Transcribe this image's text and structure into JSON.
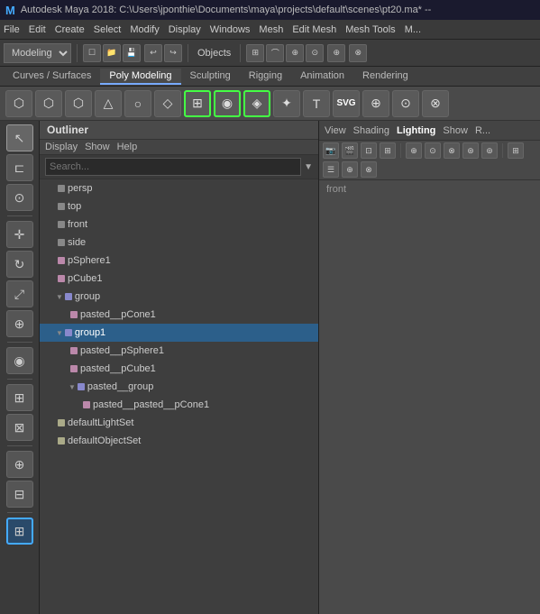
{
  "titlebar": {
    "logo": "M",
    "text": "Autodesk Maya 2018: C:\\Users\\jponthie\\Documents\\maya\\projects\\default\\scenes\\pt20.ma* --"
  },
  "menubar": {
    "items": [
      "File",
      "Edit",
      "Create",
      "Select",
      "Modify",
      "Display",
      "Windows",
      "Mesh",
      "Edit Mesh",
      "Mesh Tools",
      "M..."
    ]
  },
  "toolbar": {
    "mode": "Modeling",
    "objects_label": "Objects"
  },
  "shelf_tabs": {
    "items": [
      {
        "label": "Curves / Surfaces",
        "active": false
      },
      {
        "label": "Poly Modeling",
        "active": true
      },
      {
        "label": "Sculpting",
        "active": false
      },
      {
        "label": "Rigging",
        "active": false
      },
      {
        "label": "Animation",
        "active": false
      },
      {
        "label": "Rendering",
        "active": false
      }
    ]
  },
  "shelf_icons": [
    {
      "icon": "⬡",
      "title": "poly cube"
    },
    {
      "icon": "⬡",
      "title": "poly sphere"
    },
    {
      "icon": "⬡",
      "title": "poly cylinder"
    },
    {
      "icon": "△",
      "title": "poly cone"
    },
    {
      "icon": "○",
      "title": "poly torus"
    },
    {
      "icon": "◇",
      "title": "poly plane",
      "green": true
    },
    {
      "icon": "⊞",
      "title": "multi-cut",
      "green": true
    },
    {
      "icon": "◉",
      "title": "insert edge loop",
      "green": true
    },
    {
      "icon": "◈",
      "title": "extrude"
    },
    {
      "icon": "✦",
      "title": "bevel"
    },
    {
      "icon": "T",
      "title": "type"
    },
    {
      "icon": "SVG",
      "title": "SVG",
      "svg": true
    },
    {
      "icon": "⊕",
      "title": "camera"
    },
    {
      "icon": "⊙",
      "title": "settings"
    },
    {
      "icon": "⊗",
      "title": "close"
    }
  ],
  "outliner": {
    "title": "Outliner",
    "menu": [
      "Display",
      "Show",
      "Help"
    ],
    "search_placeholder": "Search...",
    "items": [
      {
        "label": "persp",
        "indent": 1,
        "type": "camera",
        "expand": false
      },
      {
        "label": "top",
        "indent": 1,
        "type": "camera",
        "expand": false
      },
      {
        "label": "front",
        "indent": 1,
        "type": "camera",
        "expand": false
      },
      {
        "label": "side",
        "indent": 1,
        "type": "camera",
        "expand": false
      },
      {
        "label": "pSphere1",
        "indent": 1,
        "type": "mesh",
        "expand": false
      },
      {
        "label": "pCube1",
        "indent": 1,
        "type": "mesh",
        "expand": false
      },
      {
        "label": "group",
        "indent": 1,
        "type": "group",
        "expand": true
      },
      {
        "label": "pasted__pCone1",
        "indent": 2,
        "type": "mesh",
        "expand": false
      },
      {
        "label": "group1",
        "indent": 1,
        "type": "group",
        "expand": true,
        "selected": true
      },
      {
        "label": "pasted__pSphere1",
        "indent": 2,
        "type": "mesh",
        "expand": false
      },
      {
        "label": "pasted__pCube1",
        "indent": 2,
        "type": "mesh",
        "expand": false
      },
      {
        "label": "pasted__group",
        "indent": 2,
        "type": "group",
        "expand": true
      },
      {
        "label": "pasted__pasted__pCone1",
        "indent": 3,
        "type": "mesh",
        "expand": false
      },
      {
        "label": "defaultLightSet",
        "indent": 1,
        "type": "lightset",
        "expand": false
      },
      {
        "label": "defaultObjectSet",
        "indent": 1,
        "type": "objectset",
        "expand": false
      }
    ]
  },
  "viewport": {
    "menu": [
      "View",
      "Shading",
      "Lighting",
      "Show",
      "R..."
    ],
    "lighting_active": "Lighting"
  },
  "left_tools": [
    {
      "icon": "↖",
      "label": "select",
      "active": true
    },
    {
      "icon": "↗",
      "label": "move"
    },
    {
      "icon": "⟳",
      "label": "rotate"
    },
    {
      "icon": "⤢",
      "label": "scale"
    },
    {
      "icon": "⊕",
      "label": "universal"
    },
    {
      "icon": "◉",
      "label": "soft select"
    },
    {
      "icon": "⊞",
      "label": "grid"
    },
    {
      "icon": "⊠",
      "label": "snap"
    },
    {
      "icon": "⊕",
      "label": "add"
    },
    {
      "icon": "⊟",
      "label": "layout"
    }
  ]
}
